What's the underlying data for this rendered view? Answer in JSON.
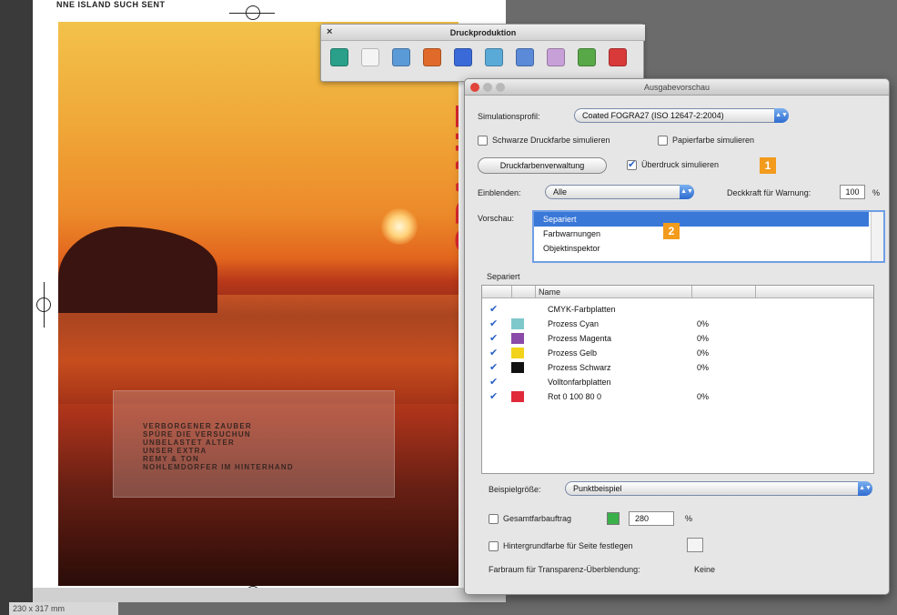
{
  "document": {
    "top_text": "NNE ISLAND SUCH SENT",
    "title_vertical": "SPANIE",
    "textbox_lines": [
      "VERBORGENER ZAUBER",
      "SPÜRE DIE VERSUCHUN",
      "UNBELASTET ALTER",
      "UNSER EXTRA",
      "REMY & TON",
      "NOHLEMDORFER IM HINTERHAND"
    ],
    "status": "230 x 317 mm"
  },
  "toolbar": {
    "title": "Druckproduktion",
    "close_glyph": "×",
    "icons": [
      {
        "name": "preflight-icon",
        "color": "#2aa08a"
      },
      {
        "name": "page-icon",
        "color": "#f4f4f4"
      },
      {
        "name": "magnify-page-icon",
        "color": "#5a9ad6"
      },
      {
        "name": "output-preview-icon",
        "color": "#e06a2a"
      },
      {
        "name": "ink-icon",
        "color": "#3a6ad8"
      },
      {
        "name": "trim-icon",
        "color": "#5aaad8"
      },
      {
        "name": "fix-hairlines-icon",
        "color": "#5a8ad8"
      },
      {
        "name": "edit-pen-icon",
        "color": "#c8a0d8"
      },
      {
        "name": "flatten-icon",
        "color": "#58a848"
      },
      {
        "name": "pdf-icon",
        "color": "#d83a3a"
      }
    ]
  },
  "panel": {
    "title": "Ausgabevorschau",
    "simulationsprofil_label": "Simulationsprofil:",
    "simulationsprofil_value": "Coated FOGRA27 (ISO 12647-2:2004)",
    "schwarze_label": "Schwarze Druckfarbe simulieren",
    "papierfarbe_label": "Papierfarbe simulieren",
    "druckfarben_button": "Druckfarbenverwaltung",
    "ueberdruck_label": "Überdruck simulieren",
    "badge1": "1",
    "einblenden_label": "Einblenden:",
    "einblenden_value": "Alle",
    "deckkraft_label": "Deckkraft für Warnung:",
    "deckkraft_value": "100",
    "deckkraft_unit": "%",
    "vorschau_label": "Vorschau:",
    "vorschau_items": [
      "Separiert",
      "Farbwarnungen",
      "Objektinspektor"
    ],
    "badge2": "2",
    "separiert_label": "Separiert",
    "name_header": "Name",
    "rows": [
      {
        "name": "CMYK-Farbplatten",
        "swatch": "",
        "percent": ""
      },
      {
        "name": "Prozess Cyan",
        "swatch": "#7ec8cc",
        "percent": "0%"
      },
      {
        "name": "Prozess Magenta",
        "swatch": "#8a4aa8",
        "percent": "0%"
      },
      {
        "name": "Prozess Gelb",
        "swatch": "#f2d21a",
        "percent": "0%"
      },
      {
        "name": "Prozess Schwarz",
        "swatch": "#111111",
        "percent": "0%"
      },
      {
        "name": "Volltonfarbplatten",
        "swatch": "",
        "percent": ""
      },
      {
        "name": "Rot 0 100 80 0",
        "swatch": "#e02a3a",
        "percent": "0%"
      }
    ],
    "beispiel_label": "Beispielgröße:",
    "beispiel_value": "Punktbeispiel",
    "gesamt_label": "Gesamtfarbauftrag",
    "gesamt_value": "280",
    "gesamt_unit": "%",
    "hintergrund_label": "Hintergrundfarbe für Seite festlegen",
    "farbraum_label": "Farbraum für Transparenz-Überblendung:",
    "farbraum_value": "Keine"
  }
}
